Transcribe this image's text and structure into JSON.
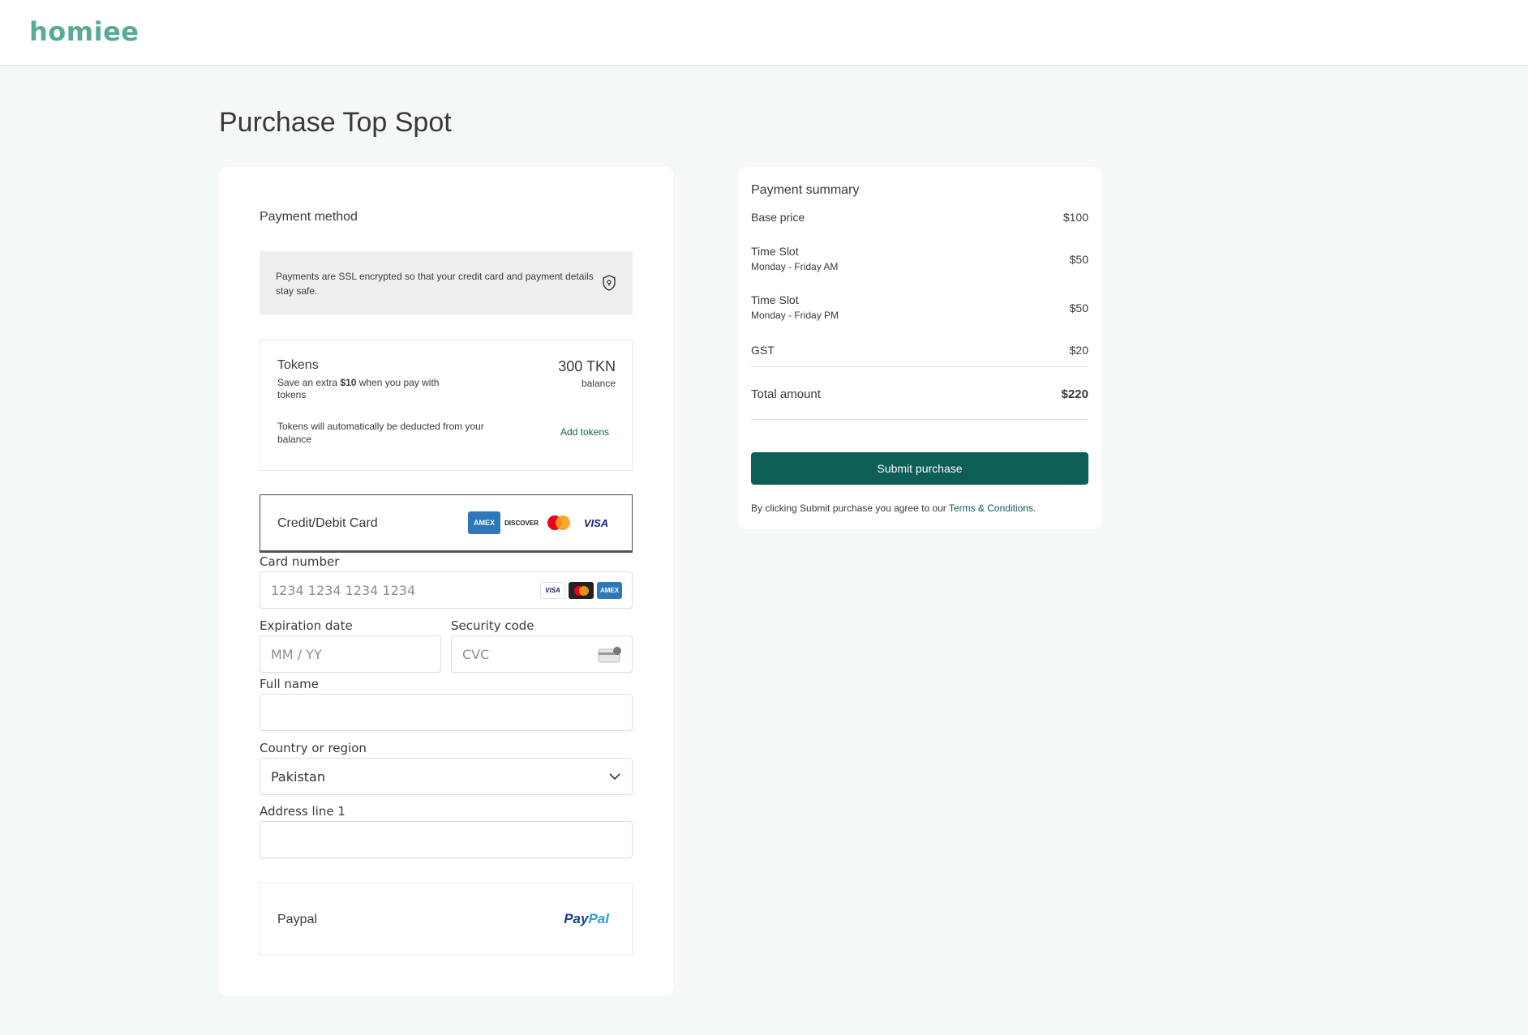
{
  "header": {
    "logo": "homiee"
  },
  "page": {
    "title": "Purchase Top Spot"
  },
  "payment": {
    "title": "Payment method",
    "ssl_note": "Payments are SSL encrypted so that your credit card and payment details stay safe.",
    "tokens": {
      "title": "Tokens",
      "save_prefix": "Save an extra ",
      "save_amount": "$10",
      "save_suffix": " when you pay with tokens",
      "amount": "300 TKN",
      "balance_label": "balance",
      "note": "Tokens will automatically be deducted from your balance",
      "add_label": "Add tokens"
    },
    "card": {
      "label": "Credit/Debit Card",
      "brands": [
        "AMEX",
        "DISCOVER",
        "MASTERCARD",
        "VISA"
      ]
    },
    "fields": {
      "card_number_label": "Card number",
      "card_number_placeholder": "1234 1234 1234 1234",
      "expiry_label": "Expiration date",
      "expiry_placeholder": "MM / YY",
      "cvc_label": "Security code",
      "cvc_placeholder": "CVC",
      "name_label": "Full name",
      "name_value": "",
      "country_label": "Country or region",
      "country_value": "Pakistan",
      "address_label": "Address line 1",
      "address_value": ""
    },
    "paypal": {
      "label": "Paypal",
      "logo_a": "Pay",
      "logo_b": "Pal"
    }
  },
  "summary": {
    "title": "Payment summary",
    "base_label": "Base price",
    "base_value": "$100",
    "slot1_label": "Time Slot",
    "slot1_sub": "Monday - Friday AM",
    "slot1_value": "$50",
    "slot2_label": "Time Slot",
    "slot2_sub": "Monday - Friday PM",
    "slot2_value": "$50",
    "gst_label": "GST",
    "gst_value": "$20",
    "total_label": "Total amount",
    "total_value": "$220",
    "submit_label": "Submit purchase",
    "terms_prefix": "By clicking Submit purchase you agree to our ",
    "terms_link": "Terms & Conditions",
    "terms_suffix": "."
  },
  "colors": {
    "brand": "#0c5e56",
    "logo": "#5aaa98",
    "background": "#f4f8f7"
  },
  "icons": [
    "shield-lock-icon",
    "chevron-down-icon",
    "cvc-card-icon"
  ]
}
